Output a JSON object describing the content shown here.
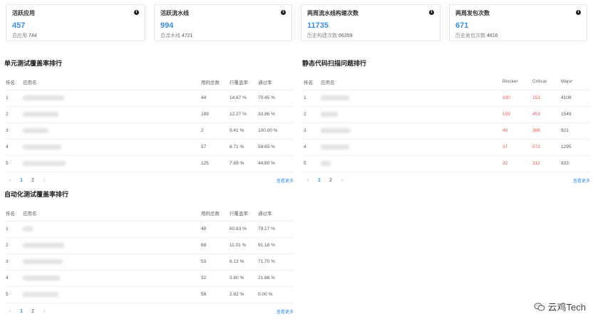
{
  "cards": [
    {
      "title": "活跃应用",
      "value": "457",
      "sub_label": "总应用",
      "sub_value": "744"
    },
    {
      "title": "活跃流水线",
      "value": "994",
      "sub_label": "总流水线",
      "sub_value": "4721"
    },
    {
      "title": "两周流水线构建次数",
      "value": "11735",
      "sub_label": "历史构建次数",
      "sub_value": "66359"
    },
    {
      "title": "两周发包次数",
      "value": "671",
      "sub_label": "历史发包次数",
      "sub_value": "4816"
    }
  ],
  "unit_test": {
    "title": "单元测试覆盖率排行",
    "headers": [
      "排名",
      "应用名",
      "用例总数",
      "行覆盖率",
      "通过率"
    ],
    "rows": [
      {
        "rank": "1",
        "cases": "44",
        "line": "14.67 %",
        "pass": "70.45 %"
      },
      {
        "rank": "2",
        "cases": "189",
        "line": "12.27 %",
        "pass": "33.86 %"
      },
      {
        "rank": "3",
        "cases": "2",
        "line": "9.41 %",
        "pass": "100.00 %"
      },
      {
        "rank": "4",
        "cases": "57",
        "line": "8.71 %",
        "pass": "59.65 %"
      },
      {
        "rank": "5",
        "cases": "125",
        "line": "7.69 %",
        "pass": "44.80 %"
      }
    ],
    "pages": [
      "1",
      "2"
    ],
    "more": "查看更多"
  },
  "static_scan": {
    "title": "静态代码扫描问题排行",
    "headers": [
      "排名",
      "应用名",
      "Blocker",
      "Critical",
      "Major"
    ],
    "rows": [
      {
        "rank": "1",
        "blocker": "330",
        "critical": "153",
        "major": "4109"
      },
      {
        "rank": "2",
        "blocker": "159",
        "critical": "453",
        "major": "1549"
      },
      {
        "rank": "3",
        "blocker": "48",
        "critical": "386",
        "major": "921"
      },
      {
        "rank": "4",
        "blocker": "37",
        "critical": "573",
        "major": "1295"
      },
      {
        "rank": "5",
        "blocker": "32",
        "critical": "312",
        "major": "933"
      }
    ],
    "pages": [
      "1",
      "2"
    ],
    "more": "查看更多"
  },
  "auto_test": {
    "title": "自动化测试覆盖率排行",
    "headers": [
      "排名",
      "应用名",
      "用例总数",
      "行覆盖率",
      "通过率"
    ],
    "rows": [
      {
        "rank": "1",
        "cases": "48",
        "line": "60.83 %",
        "pass": "79.17 %"
      },
      {
        "rank": "2",
        "cases": "68",
        "line": "11.01 %",
        "pass": "91.18 %"
      },
      {
        "rank": "3",
        "cases": "53",
        "line": "6.13 %",
        "pass": "71.70 %"
      },
      {
        "rank": "4",
        "cases": "32",
        "line": "3.80 %",
        "pass": "21.88 %"
      },
      {
        "rank": "5",
        "cases": "58",
        "line": "2.82 %",
        "pass": "0.00 %"
      }
    ],
    "pages": [
      "1",
      "2"
    ],
    "more": "查看更多"
  },
  "pager_icons": {
    "prev": "‹",
    "next": "›"
  },
  "watermark": "云鸡Tech",
  "colors": {
    "accent": "#3a8ee6",
    "danger": "#e05a4f"
  }
}
